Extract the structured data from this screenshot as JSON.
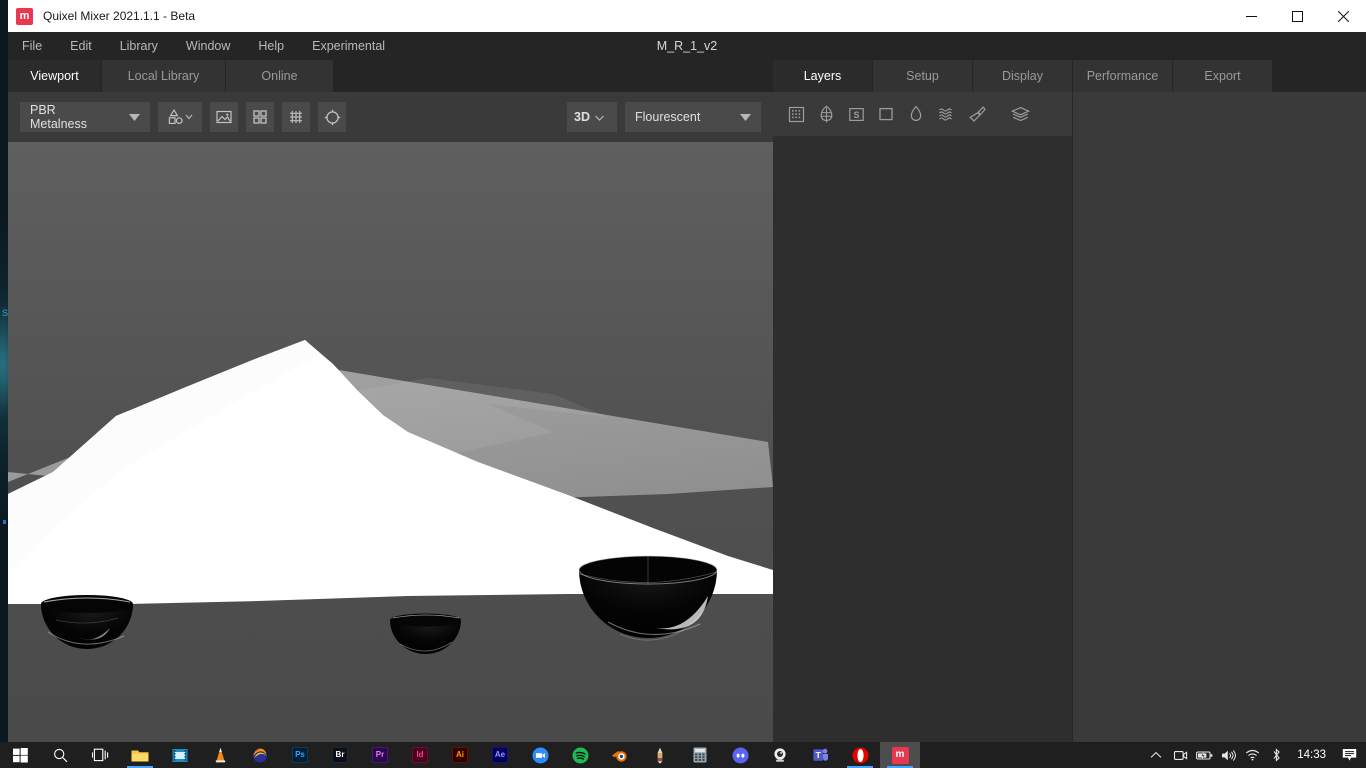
{
  "window": {
    "app_title": "Quixel Mixer 2021.1.1 - Beta",
    "logo_letter": "m",
    "document_title": "M_R_1_v2",
    "controls": [
      {
        "name": "minimize-button",
        "glyph": "minimize"
      },
      {
        "name": "maximize-button",
        "glyph": "maximize"
      },
      {
        "name": "close-button",
        "glyph": "close"
      }
    ]
  },
  "menu": {
    "items": [
      "File",
      "Edit",
      "Library",
      "Window",
      "Help",
      "Experimental"
    ]
  },
  "viewport_tabs": [
    {
      "label": "Viewport",
      "active": true
    },
    {
      "label": "Local Library",
      "active": false
    },
    {
      "label": "Online",
      "active": false
    }
  ],
  "toolbar": {
    "material_model": "PBR Metalness",
    "shapes_icon": "shapes-icon",
    "buttons": [
      {
        "name": "image-preview-button",
        "icon": "image-icon"
      },
      {
        "name": "grid-view-button",
        "icon": "grid-four-icon"
      },
      {
        "name": "mesh-grid-button",
        "icon": "mesh-grid-icon"
      },
      {
        "name": "tiling-preview-button",
        "icon": "circle-target-icon"
      }
    ],
    "view_mode": "3D",
    "lighting": "Flourescent"
  },
  "right_tabs": [
    {
      "label": "Layers",
      "active": true
    },
    {
      "label": "Setup",
      "active": false
    },
    {
      "label": "Display",
      "active": false
    },
    {
      "label": "Performance",
      "active": false
    },
    {
      "label": "Export",
      "active": false
    }
  ],
  "layers_toolbar": [
    {
      "name": "add-mask-icon",
      "icon": "dot-grid"
    },
    {
      "name": "add-surface-icon",
      "icon": "leaf"
    },
    {
      "name": "add-smart-material-icon",
      "icon": "smart-s"
    },
    {
      "name": "add-solid-layer-icon",
      "icon": "square"
    },
    {
      "name": "add-paint-layer-icon",
      "icon": "droplet"
    },
    {
      "name": "add-displace-layer-icon",
      "icon": "waves"
    },
    {
      "name": "add-brush-layer-icon",
      "icon": "brush"
    },
    {
      "name": "add-group-icon",
      "icon": "layers-stack"
    }
  ],
  "layers_list": [],
  "viewport_scene": {
    "description": "3D preview: white displaced terrain plane over grey backdrop with three black glossy hemisphere spheres",
    "background_top": "#5e5e5e",
    "background_bottom": "#4a4a4a",
    "plane_color": "#ffffff",
    "floor_color": "#9d9d9d",
    "sphere_color": "#000000"
  },
  "desktop": {
    "corner_letter": "S"
  },
  "taskbar": {
    "system": [
      {
        "name": "start-button",
        "icon": "windows-logo"
      },
      {
        "name": "search-button",
        "icon": "search-icon"
      },
      {
        "name": "task-view-button",
        "icon": "task-view-icon"
      }
    ],
    "apps": [
      {
        "name": "file-explorer",
        "label": "",
        "icon": "folder",
        "color": "#f7c43d",
        "active": false,
        "pinned_underline": true
      },
      {
        "name": "media-player",
        "label": "",
        "icon": "film",
        "color": "#1f8ac0",
        "active": false,
        "pinned_underline": false
      },
      {
        "name": "vlc",
        "label": "",
        "icon": "cone",
        "color": "#ef8a17",
        "active": false,
        "pinned_underline": false
      },
      {
        "name": "firefox",
        "label": "",
        "icon": "fox",
        "color": "#e66000",
        "active": false,
        "pinned_underline": false
      },
      {
        "name": "photoshop",
        "label": "Ps",
        "icon": "text",
        "color": "#001e36",
        "text_color": "#31a8ff",
        "active": false,
        "pinned_underline": false
      },
      {
        "name": "bridge",
        "label": "Br",
        "icon": "text",
        "color": "#0a1019",
        "text_color": "#ffffff",
        "active": false,
        "pinned_underline": false
      },
      {
        "name": "premiere-pro",
        "label": "Pr",
        "icon": "text",
        "color": "#2a0a4a",
        "text_color": "#ea77ff",
        "active": false,
        "pinned_underline": false
      },
      {
        "name": "indesign",
        "label": "Id",
        "icon": "text",
        "color": "#49021f",
        "text_color": "#ff3f8e",
        "active": false,
        "pinned_underline": false
      },
      {
        "name": "illustrator",
        "label": "Ai",
        "icon": "text",
        "color": "#330000",
        "text_color": "#ff9a00",
        "active": false,
        "pinned_underline": false
      },
      {
        "name": "after-effects",
        "label": "Ae",
        "icon": "text",
        "color": "#00005b",
        "text_color": "#9999ff",
        "active": false,
        "pinned_underline": false
      },
      {
        "name": "zoom",
        "label": "",
        "icon": "video-camera",
        "color": "#2d8cff",
        "active": false,
        "pinned_underline": false
      },
      {
        "name": "spotify",
        "label": "",
        "icon": "spotify",
        "color": "#1db954",
        "active": false,
        "pinned_underline": false
      },
      {
        "name": "blender",
        "label": "",
        "icon": "blender",
        "color": "#ea7600",
        "active": false,
        "pinned_underline": false
      },
      {
        "name": "pen-tool",
        "label": "",
        "icon": "pencil",
        "color": "#d9bba0",
        "active": false,
        "pinned_underline": false
      },
      {
        "name": "calculator",
        "label": "",
        "icon": "calculator",
        "color": "#7a8a95",
        "active": false,
        "pinned_underline": false
      },
      {
        "name": "discord",
        "label": "",
        "icon": "discord",
        "color": "#5865f2",
        "active": false,
        "pinned_underline": false
      },
      {
        "name": "webcam-app",
        "label": "",
        "icon": "webcam",
        "color": "#e8e8e8",
        "active": false,
        "pinned_underline": false
      },
      {
        "name": "microsoft-teams",
        "label": "",
        "icon": "teams",
        "color": "#5059c9",
        "active": false,
        "pinned_underline": false
      },
      {
        "name": "opera",
        "label": "",
        "icon": "opera",
        "color": "#e60000",
        "active": false,
        "pinned_underline": true
      },
      {
        "name": "quixel-mixer",
        "label": "m",
        "icon": "mixer",
        "color": "#e8384f",
        "active": true,
        "pinned_underline": true
      }
    ],
    "tray": [
      {
        "name": "show-hidden-icons",
        "icon": "chevron-up"
      },
      {
        "name": "camera-icon",
        "icon": "camera"
      },
      {
        "name": "battery-icon",
        "icon": "battery-charging"
      },
      {
        "name": "volume-icon",
        "icon": "speaker"
      },
      {
        "name": "network-icon",
        "icon": "wifi"
      },
      {
        "name": "bluetooth-icon",
        "icon": "bluetooth-pen"
      }
    ],
    "clock": "14:33",
    "notification_icon": "action-center-icon"
  }
}
